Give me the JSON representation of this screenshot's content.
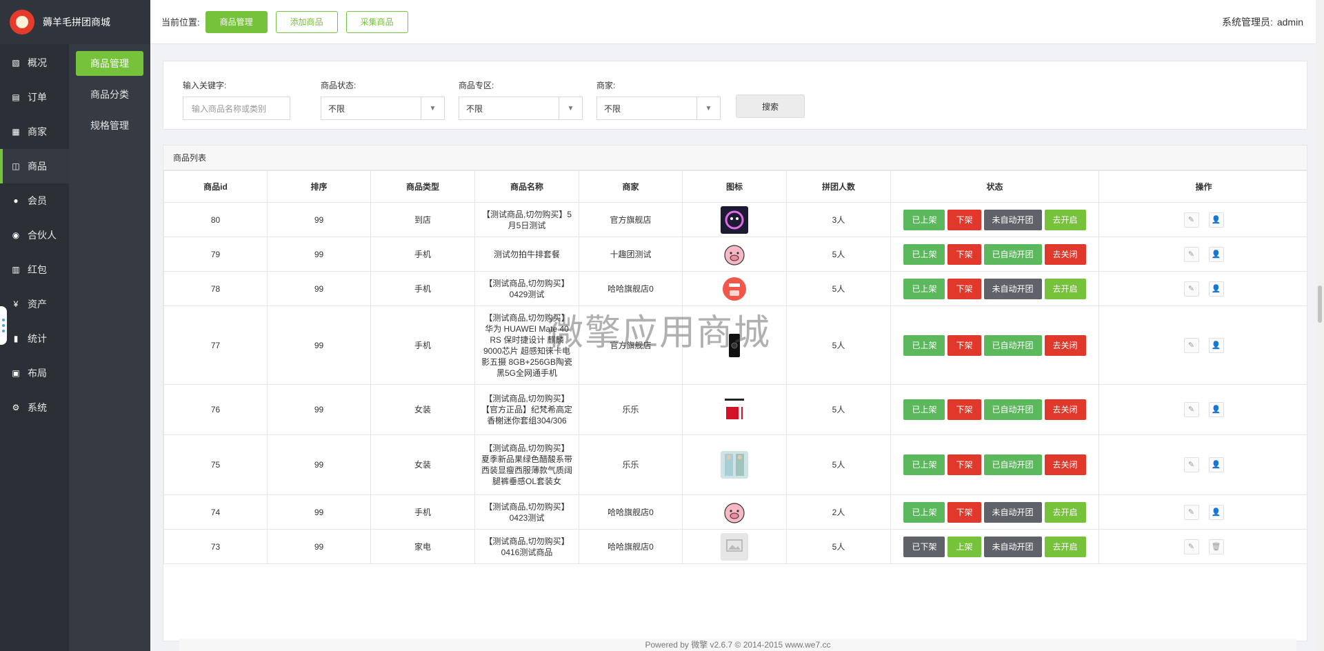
{
  "app": {
    "title": "薅羊毛拼团商城"
  },
  "nav": [
    {
      "label": "概况",
      "icon": "dashboard-icon",
      "glyph": "▧"
    },
    {
      "label": "订单",
      "icon": "order-icon",
      "glyph": "▤"
    },
    {
      "label": "商家",
      "icon": "store-icon",
      "glyph": "▦"
    },
    {
      "label": "商品",
      "icon": "product-icon",
      "glyph": "◫"
    },
    {
      "label": "会员",
      "icon": "user-icon",
      "glyph": "●"
    },
    {
      "label": "合伙人",
      "icon": "partner-icon",
      "glyph": "◉"
    },
    {
      "label": "红包",
      "icon": "redpacket-icon",
      "glyph": "▥"
    },
    {
      "label": "资产",
      "icon": "yen-icon",
      "glyph": "¥"
    },
    {
      "label": "统计",
      "icon": "stats-icon",
      "glyph": "▮"
    },
    {
      "label": "布局",
      "icon": "layout-icon",
      "glyph": "▣"
    },
    {
      "label": "系统",
      "icon": "gear-icon",
      "glyph": "⚙"
    }
  ],
  "subnav": [
    "商品管理",
    "商品分类",
    "规格管理"
  ],
  "topbar": {
    "crumb_label": "当前位置:",
    "tabs": [
      "商品管理",
      "添加商品",
      "采集商品"
    ],
    "admin_label": "系统管理员:",
    "admin_name": "admin"
  },
  "filters": {
    "keyword_label": "输入关键字:",
    "keyword_placeholder": "输入商品名称或类别",
    "status_label": "商品状态:",
    "status_value": "不限",
    "zone_label": "商品专区:",
    "zone_value": "不限",
    "merchant_label": "商家:",
    "merchant_value": "不限",
    "search_label": "搜索"
  },
  "table": {
    "title": "商品列表",
    "columns": [
      "商品id",
      "排序",
      "商品类型",
      "商品名称",
      "商家",
      "图标",
      "拼团人数",
      "状态",
      "操作"
    ],
    "rows": [
      {
        "id": "80",
        "sort": "99",
        "type": "到店",
        "name": "【测试商品,切勿购买】5月5日测试",
        "merchant": "官方旗舰店",
        "thumb": "circle",
        "count": "3人",
        "s1": "已上架",
        "s1c": "green",
        "s2": "下架",
        "s2c": "red",
        "s3": "未自动开团",
        "s3c": "gray",
        "s4": "去开启",
        "s4c": "lime",
        "ops": [
          "edit-icon",
          "add-user-icon"
        ]
      },
      {
        "id": "79",
        "sort": "99",
        "type": "手机",
        "name": "测试勿拍牛排套餐",
        "merchant": "十趣团测试",
        "thumb": "pig",
        "count": "5人",
        "s1": "已上架",
        "s1c": "green",
        "s2": "下架",
        "s2c": "red",
        "s3": "已自动开团",
        "s3c": "green",
        "s4": "去关闭",
        "s4c": "red",
        "ops": [
          "edit-icon",
          "add-user-icon"
        ]
      },
      {
        "id": "78",
        "sort": "99",
        "type": "手机",
        "name": "【测试商品,切勿购买】0429测试",
        "merchant": "哈哈旗舰店0",
        "thumb": "newbie",
        "count": "5人",
        "s1": "已上架",
        "s1c": "green",
        "s2": "下架",
        "s2c": "red",
        "s3": "未自动开团",
        "s3c": "gray",
        "s4": "去开启",
        "s4c": "lime",
        "ops": [
          "edit-icon",
          "add-user-icon"
        ]
      },
      {
        "id": "77",
        "sort": "99",
        "type": "手机",
        "name": "【测试商品,切勿购买】华为 HUAWEI Mate 40 RS 保时捷设计 麒麟9000芯片 超感知徕卡电影五摄 8GB+256GB陶瓷黑5G全网通手机",
        "merchant": "官方旗舰店",
        "thumb": "phone",
        "count": "5人",
        "s1": "已上架",
        "s1c": "green",
        "s2": "下架",
        "s2c": "red",
        "s3": "已自动开团",
        "s3c": "green",
        "s4": "去关闭",
        "s4c": "red",
        "ops": [
          "edit-icon",
          "add-user-icon"
        ]
      },
      {
        "id": "76",
        "sort": "99",
        "type": "女装",
        "name": "【测试商品,切勿购买】【官方正品】纪梵希高定香榭迷你套组304/306",
        "merchant": "乐乐",
        "thumb": "lipstick",
        "count": "5人",
        "s1": "已上架",
        "s1c": "green",
        "s2": "下架",
        "s2c": "red",
        "s3": "已自动开团",
        "s3c": "green",
        "s4": "去关闭",
        "s4c": "red",
        "ops": [
          "edit-icon",
          "add-user-icon"
        ]
      },
      {
        "id": "75",
        "sort": "99",
        "type": "女装",
        "name": "【测试商品,切勿购买】夏季新品果绿色醋酸系带西装显瘦西服薄款气质阔腿裤垂感OL套装女",
        "merchant": "乐乐",
        "thumb": "fashion",
        "count": "5人",
        "s1": "已上架",
        "s1c": "green",
        "s2": "下架",
        "s2c": "red",
        "s3": "已自动开团",
        "s3c": "green",
        "s4": "去关闭",
        "s4c": "red",
        "ops": [
          "edit-icon",
          "add-user-icon"
        ]
      },
      {
        "id": "74",
        "sort": "99",
        "type": "手机",
        "name": "【测试商品,切勿购买】0423测试",
        "merchant": "哈哈旗舰店0",
        "thumb": "pig",
        "count": "2人",
        "s1": "已上架",
        "s1c": "green",
        "s2": "下架",
        "s2c": "red",
        "s3": "未自动开团",
        "s3c": "gray",
        "s4": "去开启",
        "s4c": "lime",
        "ops": [
          "edit-icon",
          "add-user-icon"
        ]
      },
      {
        "id": "73",
        "sort": "99",
        "type": "家电",
        "name": "【测试商品,切勿购买】0416测试商品",
        "merchant": "哈哈旗舰店0",
        "thumb": "placeholder",
        "count": "5人",
        "s1": "已下架",
        "s1c": "gray",
        "s2": "上架",
        "s2c": "lime",
        "s3": "未自动开团",
        "s3c": "gray",
        "s4": "去开启",
        "s4c": "lime",
        "ops": [
          "edit-icon",
          "trash-icon"
        ]
      }
    ]
  },
  "watermark": "微擎应用商城",
  "footer": "Powered by 微擎 v2.6.7 © 2014-2015 www.we7.cc",
  "colors": {
    "accent": "#76c23b",
    "sidebar": "#2b2f36",
    "danger": "#e0382a",
    "success": "#5cb85c",
    "neutral": "#5f6369"
  }
}
